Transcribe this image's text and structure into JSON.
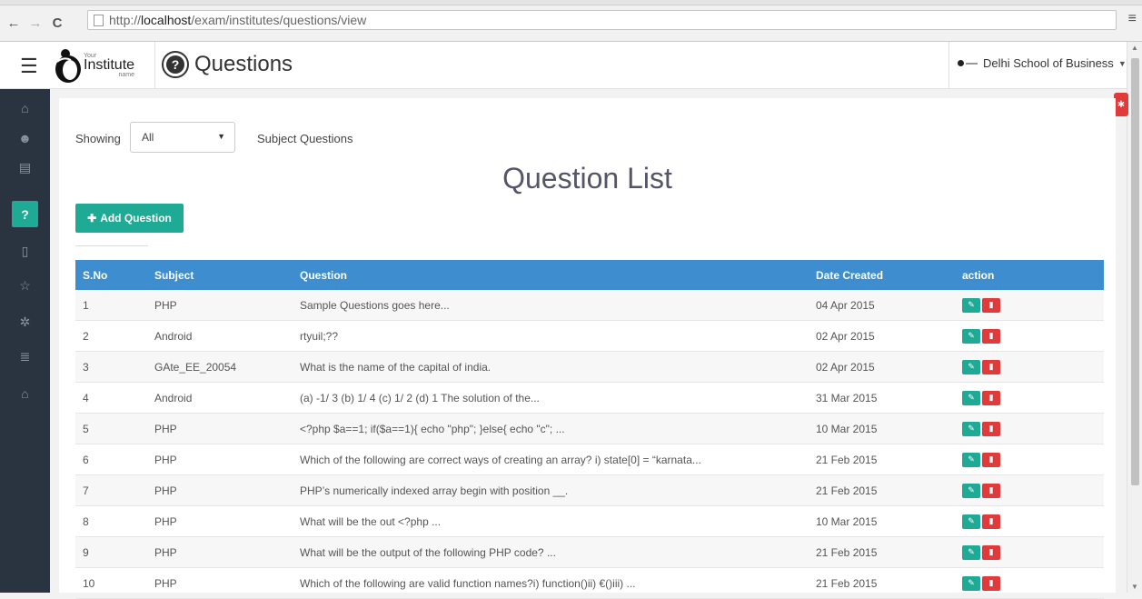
{
  "browser": {
    "url_prefix": "http://",
    "url_host": "localhost",
    "url_path": "/exam/institutes/questions/view",
    "back": "←",
    "forward": "→",
    "reload": "C",
    "menu": "≡"
  },
  "header": {
    "logo_your": "Your",
    "logo_institute": "Institute",
    "logo_name": "name",
    "title": "Questions",
    "school": "Delhi School of Business"
  },
  "sidebar": {
    "items": [
      {
        "icon": "home-icon",
        "glyph": "⌂"
      },
      {
        "icon": "users-icon",
        "glyph": "☻"
      },
      {
        "icon": "list-icon",
        "glyph": "▤"
      },
      {
        "icon": "question-icon",
        "glyph": "?"
      },
      {
        "icon": "document-icon",
        "glyph": "▯"
      },
      {
        "icon": "star-icon",
        "glyph": "☆"
      },
      {
        "icon": "gear-icon",
        "glyph": "✲"
      },
      {
        "icon": "menu-list-icon",
        "glyph": "≣"
      },
      {
        "icon": "institution-icon",
        "glyph": "⌂"
      }
    ]
  },
  "filter": {
    "showing_label": "Showing",
    "selected": "All",
    "suffix_label": "Subject Questions"
  },
  "main": {
    "heading": "Question List",
    "add_button": "Add Question"
  },
  "table": {
    "headers": [
      "S.No",
      "Subject",
      "Question",
      "Date Created",
      "action"
    ],
    "rows": [
      {
        "sno": "1",
        "subject": "PHP",
        "question": "Sample Questions goes here...",
        "date": "04 Apr 2015"
      },
      {
        "sno": "2",
        "subject": "Android",
        "question": "rtyuil;??",
        "date": "02 Apr 2015"
      },
      {
        "sno": "3",
        "subject": "GAte_EE_20054",
        "question": "What is the name of the capital of india.",
        "date": "02 Apr 2015"
      },
      {
        "sno": "4",
        "subject": "Android",
        "question": "(a) -1/ 3  (b) 1/ 4 (c) 1/ 2 (d) 1  The solution of the...",
        "date": "31 Mar 2015"
      },
      {
        "sno": "5",
        "subject": "PHP",
        "question": "<?php $a==1; if($a==1){ echo \"php\"; }else{ echo \"c\"; ...",
        "date": "10 Mar 2015"
      },
      {
        "sno": "6",
        "subject": "PHP",
        "question": "Which of the following are correct ways of creating an array? i) state[0] = “karnata...",
        "date": "21 Feb 2015"
      },
      {
        "sno": "7",
        "subject": "PHP",
        "question": "PHP’s numerically indexed array begin with position __.",
        "date": "21 Feb 2015"
      },
      {
        "sno": "8",
        "subject": "PHP",
        "question": "What will be the out <?php ...",
        "date": "10 Mar 2015"
      },
      {
        "sno": "9",
        "subject": "PHP",
        "question": "What will be the output of the following PHP code? ...",
        "date": "21 Feb 2015"
      },
      {
        "sno": "10",
        "subject": "PHP",
        "question": "Which of the following are valid function names?i) function()ii) €()iii) ...",
        "date": "21 Feb 2015"
      }
    ]
  }
}
